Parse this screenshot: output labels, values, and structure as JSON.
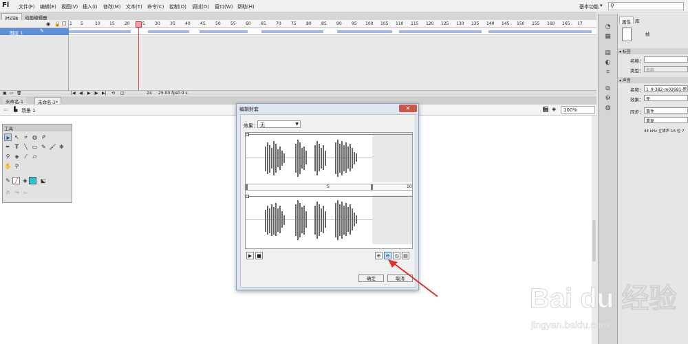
{
  "app": {
    "logo": "Fl",
    "menu": [
      "文件(F)",
      "编辑(E)",
      "视图(V)",
      "插入(I)",
      "修改(M)",
      "文本(T)",
      "命令(C)",
      "控制(O)",
      "调试(D)",
      "窗口(W)",
      "帮助(H)"
    ],
    "workspace": "基本功能",
    "search_placeholder": ""
  },
  "timeline": {
    "tabs": [
      "时间轴",
      "动画编辑器"
    ],
    "layer_name": "图层 1",
    "ruler_ticks": [
      "1",
      "5",
      "10",
      "15",
      "20",
      "25",
      "30",
      "35",
      "40",
      "45",
      "50",
      "55",
      "60",
      "65",
      "70",
      "75",
      "80",
      "85",
      "90",
      "95",
      "100",
      "105",
      "110",
      "115",
      "120",
      "125",
      "130",
      "135",
      "140",
      "145",
      "150",
      "155",
      "160",
      "165",
      "17"
    ],
    "current_frame": "24",
    "fps": "25.00 fps",
    "time": "0.9 s"
  },
  "document": {
    "tabs": [
      "未命名-1",
      "未命名-2*"
    ],
    "scene": "场景 1",
    "zoom": "100%"
  },
  "tools": {
    "title": "工具"
  },
  "dialog": {
    "title": "编辑封套",
    "effect_label": "效果：",
    "effect_value": "无",
    "ruler_label_5": "5",
    "ruler_label_10": "10",
    "ok": "确定",
    "cancel": "取消"
  },
  "properties": {
    "tabs": [
      "属性",
      "库"
    ],
    "object_type": "帧",
    "label_section": "标签",
    "name_label": "名称：",
    "name_value": "",
    "type_label": "类型：",
    "type_value": "名称",
    "sound_section": "声音",
    "sound_name_label": "名称：",
    "sound_name_value": "1_9-382-m02681-医生",
    "effect_label": "效果：",
    "effect_value": "无",
    "sync_label": "同步：",
    "sync_value": "事件",
    "repeat_value": "重复",
    "sound_info": "44 kHz 立体声 16 位 7"
  },
  "watermark": {
    "brand": "Bai du 经验",
    "url": "jingyan.baidu.com"
  },
  "colors": {
    "accent": "#5c8fd6",
    "playhead": "#e05050",
    "annotation_arrow": "#e0302b"
  }
}
